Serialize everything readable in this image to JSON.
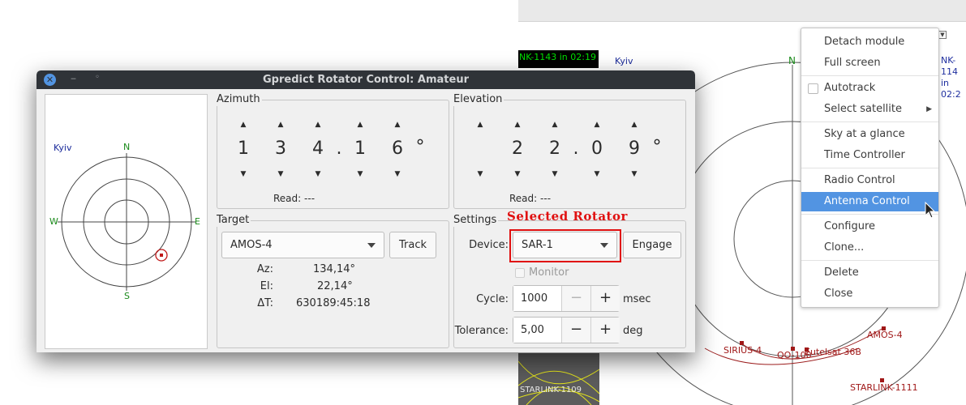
{
  "background_module": {
    "next_pass": "NK-1143 in 02:19",
    "next_pass_right_line1": "NK-114",
    "next_pass_right_line2": "in 02:2",
    "qth": "Kyiv",
    "north": "N",
    "satellites": [
      "SIRIUS-4",
      "QO-100",
      "Eutelsat 36B",
      "AMOS-4",
      "STARLINK-1111"
    ],
    "ground_track_label": "STARLINK-1109"
  },
  "context_menu": {
    "items": [
      {
        "label": "Detach module"
      },
      {
        "label": "Full screen"
      },
      {
        "label": "Autotrack"
      },
      {
        "label": "Select satellite"
      },
      {
        "label": "Sky at a glance"
      },
      {
        "label": "Time Controller"
      },
      {
        "label": "Radio Control"
      },
      {
        "label": "Antenna Control"
      },
      {
        "label": "Configure"
      },
      {
        "label": "Clone..."
      },
      {
        "label": "Delete"
      },
      {
        "label": "Close"
      }
    ],
    "highlighted": "Antenna Control",
    "autotrack_checked": false
  },
  "window": {
    "title": "Gpredict Rotator Control: Amateur",
    "polar": {
      "qth": "Kyiv",
      "n": "N",
      "s": "S",
      "e": "E",
      "w": "W"
    },
    "azimuth": {
      "title": "Azimuth",
      "digits": [
        "1",
        "3",
        "4",
        ".",
        "1",
        "6"
      ],
      "degree": "°",
      "read_label": "Read:",
      "read_value": "---"
    },
    "elevation": {
      "title": "Elevation",
      "digits": [
        "",
        "2",
        "2",
        ".",
        "0",
        "9"
      ],
      "degree": "°",
      "read_label": "Read:",
      "read_value": "---"
    },
    "target": {
      "title": "Target",
      "satellite": "AMOS-4",
      "track_button": "Track",
      "az_label": "Az:",
      "az_value": "134,14°",
      "el_label": "El:",
      "el_value": "22,14°",
      "dt_label": "ΔT:",
      "dt_value": "630189:45:18"
    },
    "settings": {
      "title": "Settings",
      "device_label": "Device:",
      "device_value": "SAR-1",
      "engage_button": "Engage",
      "monitor_label": "Monitor",
      "monitor_checked": false,
      "cycle_label": "Cycle:",
      "cycle_value": "1000",
      "cycle_unit": "msec",
      "tolerance_label": "Tolerance:",
      "tolerance_value": "5,00",
      "tolerance_unit": "deg",
      "minus": "−",
      "plus": "+"
    }
  },
  "annotation": {
    "label": "Selected Rotator",
    "color": "#e01010"
  },
  "colors": {
    "titlebar": "#2f3338",
    "menu_highlight": "#5294e2",
    "sat_marker": "#a01818",
    "qth_text": "#1a2a9a",
    "compass_text": "#1a8a1a"
  }
}
